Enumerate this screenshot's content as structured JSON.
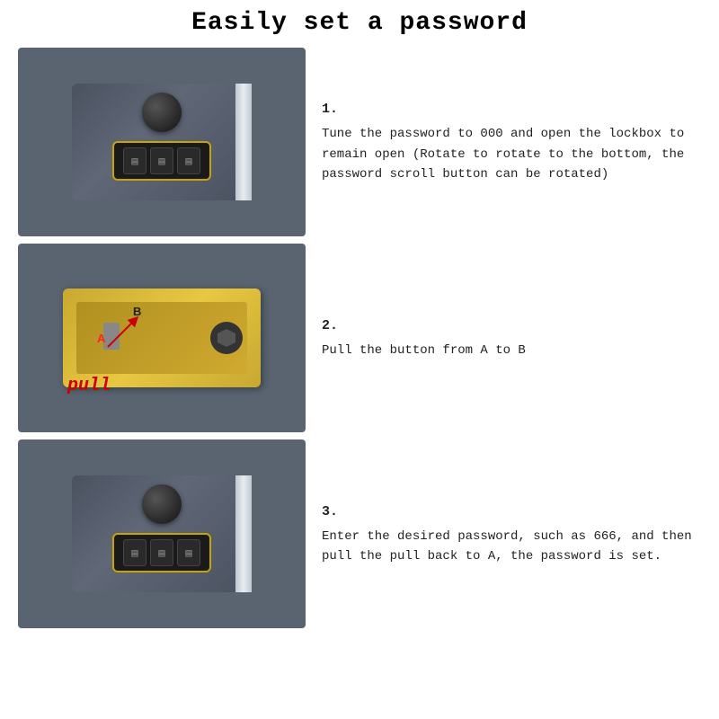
{
  "page": {
    "title": "Easily set a password",
    "steps": [
      {
        "number": "1.",
        "text": "Tune the password to 000 and open the lockbox to remain open (Rotate to rotate to the bottom, the password scroll button can be rotated)"
      },
      {
        "number": "2.",
        "text": "Pull the button from A to B"
      },
      {
        "number": "3.",
        "text": "Enter the desired password, such as 666, and then pull the pull back to A,  the password is set."
      }
    ],
    "pull_label": "pull",
    "label_a": "A",
    "label_b": "B"
  }
}
